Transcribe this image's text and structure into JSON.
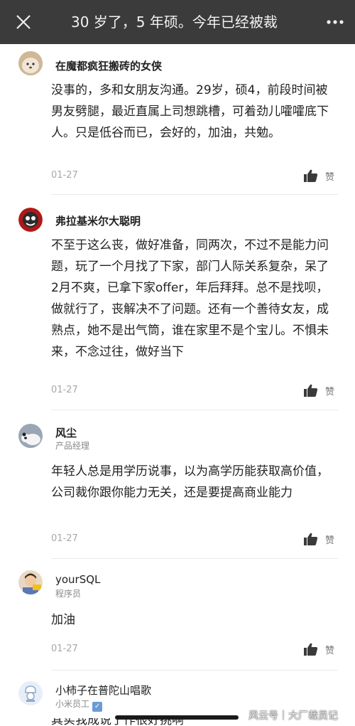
{
  "header": {
    "title": "30 岁了，5 年硕。今年已经被裁",
    "close_icon": "close-icon",
    "more_icon": "more-dots-icon"
  },
  "like_label": "赞",
  "comments": [
    {
      "user": "在魔都疯狂搬砖的女侠",
      "role": "",
      "text": "没事的，多和女朋友沟通。29岁，硕4，前段时间被男友劈腿，最近直属上司想跳槽，可着劲儿嚯嚯底下人。只是低谷而已，会好的，加油，共勉。",
      "date": "01-27"
    },
    {
      "user": "弗拉基米尔大聪明",
      "role": "",
      "text": "不至于这么丧，做好准备，同两次，不过不是能力问题，玩了一个月找了下家，部门人际关系复杂，呆了2月不爽，已拿下家offer，年后拜拜。总不是找呗，做就行了，丧解决不了问题。还有一个善待女友，成熟点，她不是出气筒，谁在家里不是个宝儿。不惧未来，不念过往，做好当下",
      "date": "01-27"
    },
    {
      "user": "风尘",
      "role": "产品经理",
      "text": "年轻人总是用学历说事，以为高学历能获取高价值，公司裁你跟你能力无关，还是要提高商业能力",
      "date": "01-27"
    },
    {
      "user": "yourSQL",
      "role": "程序员",
      "text": "加油",
      "date": "01-27"
    },
    {
      "user": "小柿子在普陀山唱歌",
      "role": "小米员工",
      "text": "其实我成说了作很好挑啊",
      "date": ""
    }
  ],
  "watermark": "风云号｜大厂裁员记"
}
